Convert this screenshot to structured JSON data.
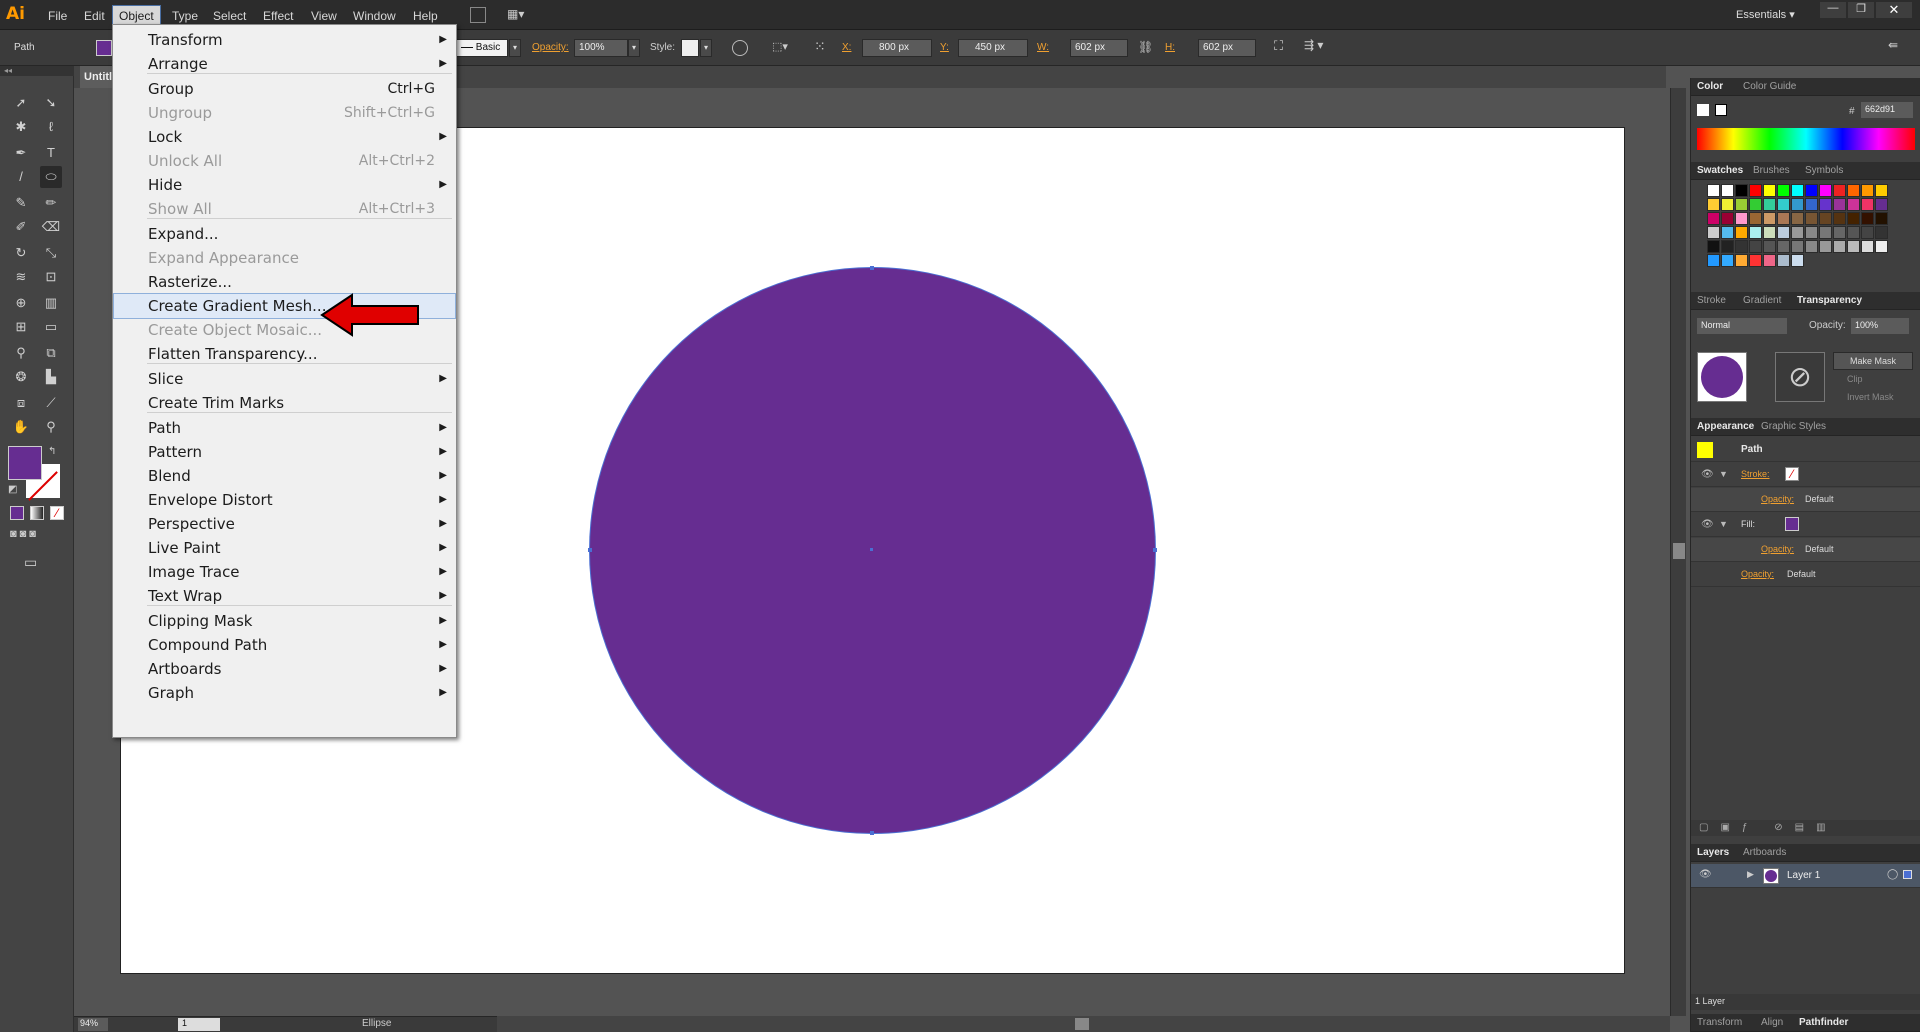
{
  "app": {
    "logo": "Ai",
    "workspace": "Essentials"
  },
  "menubar": [
    "File",
    "Edit",
    "Object",
    "Type",
    "Select",
    "Effect",
    "View",
    "Window",
    "Help"
  ],
  "control": {
    "selection": "Path",
    "stroke_style": "Basic",
    "opacity_label": "Opacity:",
    "opacity": "100%",
    "style_label": "Style:",
    "x_label": "X:",
    "x": "800 px",
    "y_label": "Y:",
    "y": "450 px",
    "w_label": "W:",
    "w": "602 px",
    "h_label": "H:",
    "h": "602 px"
  },
  "document_tab": "Untitl",
  "object_menu": [
    {
      "label": "Transform",
      "shortcut": "",
      "submenu": true,
      "disabled": false
    },
    {
      "label": "Arrange",
      "shortcut": "",
      "submenu": true,
      "disabled": false
    },
    {
      "label": "Group",
      "shortcut": "Ctrl+G",
      "submenu": false,
      "disabled": false
    },
    {
      "label": "Ungroup",
      "shortcut": "Shift+Ctrl+G",
      "submenu": false,
      "disabled": true
    },
    {
      "label": "Lock",
      "shortcut": "",
      "submenu": true,
      "disabled": false
    },
    {
      "label": "Unlock All",
      "shortcut": "Alt+Ctrl+2",
      "submenu": false,
      "disabled": true
    },
    {
      "label": "Hide",
      "shortcut": "",
      "submenu": true,
      "disabled": false
    },
    {
      "label": "Show All",
      "shortcut": "Alt+Ctrl+3",
      "submenu": false,
      "disabled": true
    },
    {
      "label": "Expand...",
      "shortcut": "",
      "submenu": false,
      "disabled": false
    },
    {
      "label": "Expand Appearance",
      "shortcut": "",
      "submenu": false,
      "disabled": true
    },
    {
      "label": "Rasterize...",
      "shortcut": "",
      "submenu": false,
      "disabled": false
    },
    {
      "label": "Create Gradient Mesh...",
      "shortcut": "",
      "submenu": false,
      "disabled": false,
      "highlighted": true
    },
    {
      "label": "Create Object Mosaic...",
      "shortcut": "",
      "submenu": false,
      "disabled": true
    },
    {
      "label": "Flatten Transparency...",
      "shortcut": "",
      "submenu": false,
      "disabled": false
    },
    {
      "label": "Slice",
      "shortcut": "",
      "submenu": true,
      "disabled": false
    },
    {
      "label": "Create Trim Marks",
      "shortcut": "",
      "submenu": false,
      "disabled": false
    },
    {
      "label": "Path",
      "shortcut": "",
      "submenu": true,
      "disabled": false
    },
    {
      "label": "Pattern",
      "shortcut": "",
      "submenu": true,
      "disabled": false
    },
    {
      "label": "Blend",
      "shortcut": "",
      "submenu": true,
      "disabled": false
    },
    {
      "label": "Envelope Distort",
      "shortcut": "",
      "submenu": true,
      "disabled": false
    },
    {
      "label": "Perspective",
      "shortcut": "",
      "submenu": true,
      "disabled": false
    },
    {
      "label": "Live Paint",
      "shortcut": "",
      "submenu": true,
      "disabled": false
    },
    {
      "label": "Image Trace",
      "shortcut": "",
      "submenu": true,
      "disabled": false
    },
    {
      "label": "Text Wrap",
      "shortcut": "",
      "submenu": true,
      "disabled": false
    },
    {
      "label": "Clipping Mask",
      "shortcut": "",
      "submenu": true,
      "disabled": false
    },
    {
      "label": "Compound Path",
      "shortcut": "",
      "submenu": true,
      "disabled": false
    },
    {
      "label": "Artboards",
      "shortcut": "",
      "submenu": true,
      "disabled": false
    },
    {
      "label": "Graph",
      "shortcut": "",
      "submenu": true,
      "disabled": false
    }
  ],
  "color_panel": {
    "tabs": [
      "Color",
      "Color Guide"
    ],
    "hex": "662d91"
  },
  "swatches_panel": {
    "tabs": [
      "Swatches",
      "Brushes",
      "Symbols"
    ]
  },
  "transparency_panel": {
    "tabs": [
      "Stroke",
      "Gradient",
      "Transparency"
    ],
    "blend_mode": "Normal",
    "opacity_label": "Opacity:",
    "opacity": "100%",
    "make_mask": "Make Mask",
    "clip": "Clip",
    "invert_mask": "Invert Mask"
  },
  "appearance_panel": {
    "tabs": [
      "Appearance",
      "Graphic Styles"
    ],
    "title": "Path",
    "stroke_label": "Stroke:",
    "fill_label": "Fill:",
    "opacity_label": "Opacity:",
    "opacity_value": "Default"
  },
  "layers_panel": {
    "tabs": [
      "Layers",
      "Artboards"
    ],
    "layer": "Layer 1",
    "count": "1 Layer"
  },
  "bottom_tabs": [
    "Transform",
    "Align",
    "Pathfinder"
  ],
  "status": {
    "zoom": "94%",
    "artboard": "1",
    "tool": "Ellipse"
  },
  "colors": {
    "fill": "#662d91",
    "selection": "#4b6fd3"
  }
}
